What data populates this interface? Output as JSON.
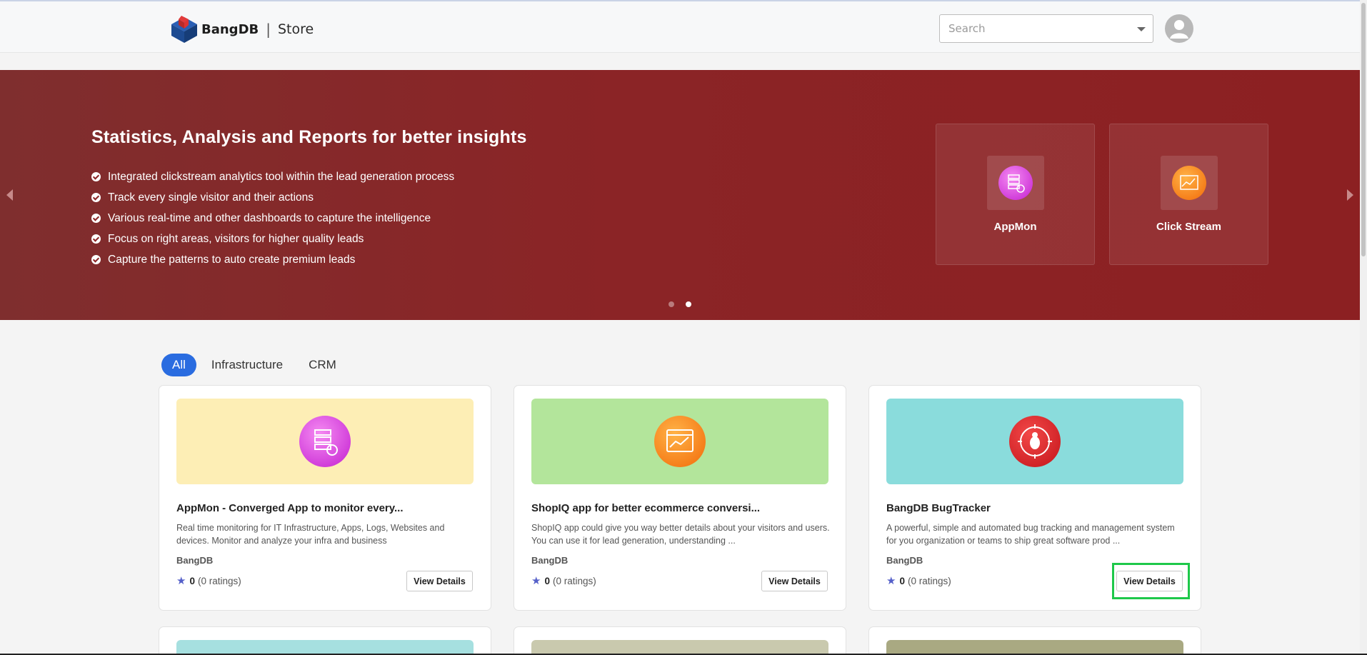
{
  "header": {
    "brand_name": "BangDB",
    "brand_separator": "|",
    "brand_section": "Store",
    "search_placeholder": "Search"
  },
  "hero": {
    "title": "Statistics, Analysis and Reports for better insights",
    "bullets": [
      "Integrated clickstream analytics tool within the lead generation process",
      "Track every single visitor and their actions",
      "Various real-time and other dashboards to capture the intelligence",
      "Focus on right areas, visitors for higher quality leads",
      "Capture the patterns to auto create premium leads"
    ],
    "apps": [
      {
        "name": "AppMon",
        "icon": "server-monitor-icon"
      },
      {
        "name": "Click Stream",
        "icon": "clickstream-chart-icon"
      }
    ],
    "slides": 2,
    "active_slide": 2,
    "background_color": "#8b2426"
  },
  "tabs": [
    {
      "label": "All",
      "active": true
    },
    {
      "label": "Infrastructure",
      "active": false
    },
    {
      "label": "CRM",
      "active": false
    }
  ],
  "cards": [
    {
      "title": "AppMon - Converged App to monitor every...",
      "description": "Real time monitoring for IT Infrastructure, Apps, Logs, Websites and devices. Monitor and analyze your infra and business",
      "vendor": "BangDB",
      "rating": "0",
      "ratings_count": "(0 ratings)",
      "button": "View Details",
      "banner_color": "#fdeeb5",
      "icon": "server-monitor-icon"
    },
    {
      "title": "ShopIQ app for better ecommerce conversi...",
      "description": "ShopIQ app could give you way better details about your visitors and users. You can use it for lead generation, understanding ...",
      "vendor": "BangDB",
      "rating": "0",
      "ratings_count": "(0 ratings)",
      "button": "View Details",
      "banner_color": "#b3e59b",
      "icon": "web-analytics-icon"
    },
    {
      "title": "BangDB BugTracker",
      "description": "A powerful, simple and automated bug tracking and management system for you organization or teams to ship great software prod ...",
      "vendor": "BangDB",
      "rating": "0",
      "ratings_count": "(0 ratings)",
      "button": "View Details",
      "banner_color": "#8adcdc",
      "icon": "bug-icon"
    }
  ],
  "next_row_banner_colors": [
    "#a6e0e0",
    "#c9c9ae",
    "#a9a982"
  ],
  "colors": {
    "accent": "#2a6ce0",
    "highlight": "#1ec84a",
    "star": "#5560c9"
  }
}
